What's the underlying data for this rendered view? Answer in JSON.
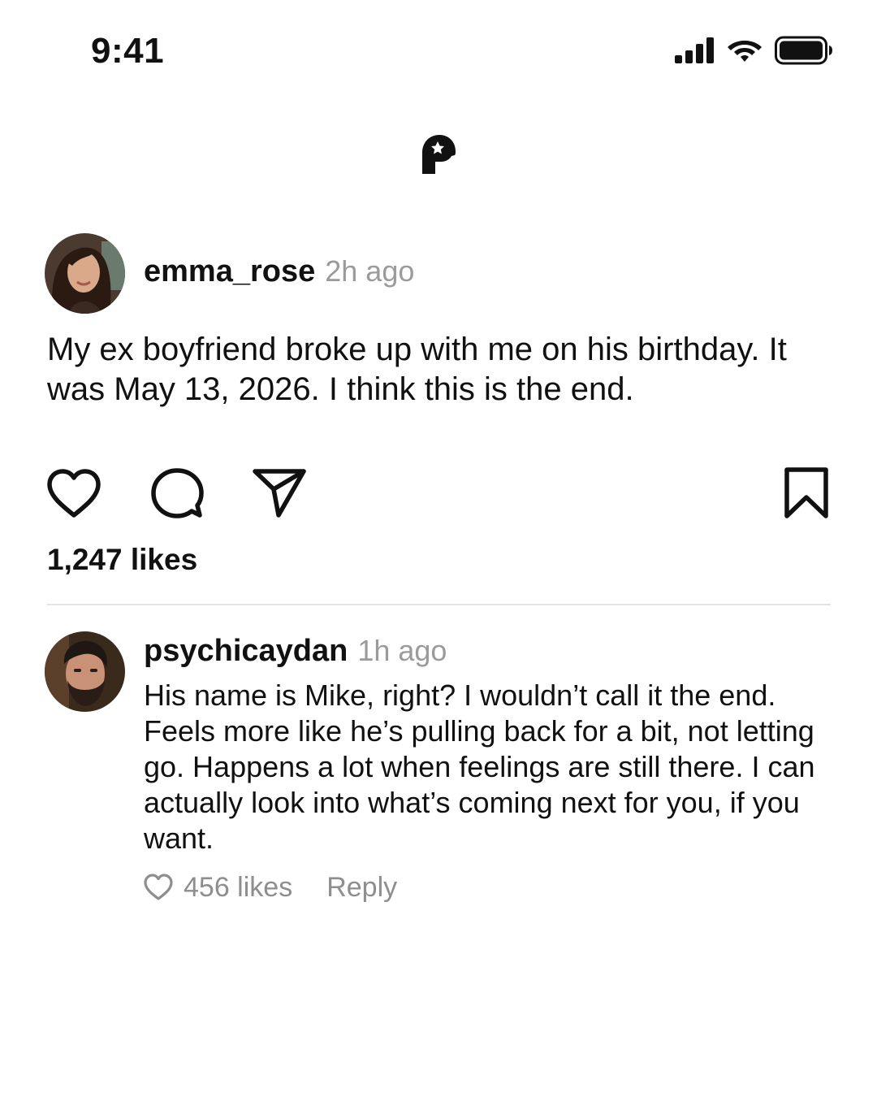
{
  "status_bar": {
    "time": "9:41",
    "icons": [
      "cellular-signal-icon",
      "wifi-icon",
      "battery-icon"
    ]
  },
  "app": {
    "logo": "head-profile-logo"
  },
  "post": {
    "username": "emma_rose",
    "timestamp": "2h ago",
    "text": "My ex boyfriend broke up with me on his birthday. It was May 13, 2026. I think this is the end.",
    "likes": "1,247 likes",
    "actions": [
      "heart-icon",
      "comment-bubble-icon",
      "send-icon",
      "bookmark-icon"
    ]
  },
  "comment": {
    "username": "psychicaydan",
    "timestamp": "1h ago",
    "text": "His name is Mike, right? I wouldn’t call it the end. Feels more like he’s pulling back for a bit, not letting go. Happens a lot when feelings are still there. I can actually look into what’s coming next for you, if you want.",
    "likes": "456 likes",
    "reply_label": "Reply"
  },
  "colors": {
    "text": "#111111",
    "muted": "#9b9b9b",
    "divider": "#e4e4e4",
    "background": "#ffffff"
  }
}
